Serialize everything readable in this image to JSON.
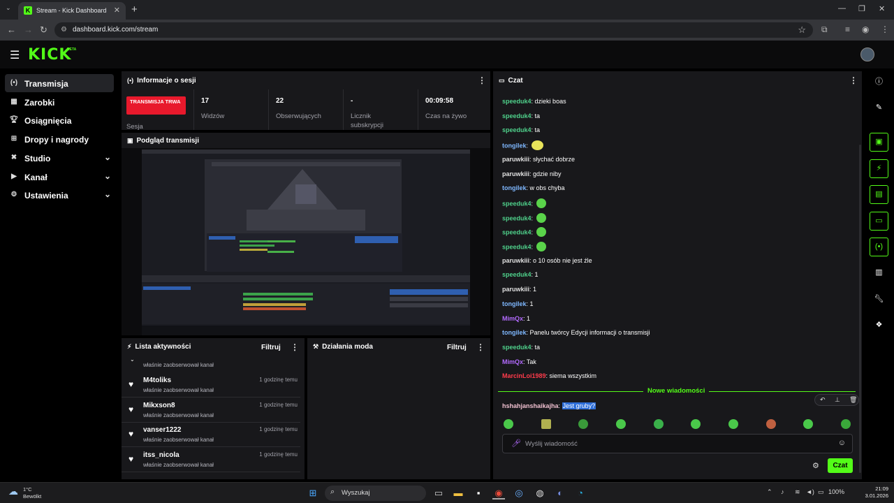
{
  "browser": {
    "tab_title": "Stream - Kick Dashboard",
    "tab_favicon": "K",
    "url": "dashboard.kick.com/stream"
  },
  "header": {
    "logo": "KICK",
    "logo_badge": "BETA"
  },
  "sidebar": {
    "items": [
      {
        "label": "Transmisja",
        "icon": "broadcast-icon"
      },
      {
        "label": "Zarobki",
        "icon": "earnings-icon"
      },
      {
        "label": "Osiągnięcia",
        "icon": "trophy-icon"
      },
      {
        "label": "Dropy i nagrody",
        "icon": "gift-icon"
      },
      {
        "label": "Studio",
        "icon": "studio-icon"
      },
      {
        "label": "Kanał",
        "icon": "channel-icon"
      },
      {
        "label": "Ustawienia",
        "icon": "settings-icon"
      }
    ]
  },
  "session": {
    "title": "Informacje o sesji",
    "status_badge": "TRANSMISJA TRWA",
    "status_label": "Sesja",
    "stats": [
      {
        "value": "17",
        "label": "Widzów"
      },
      {
        "value": "22",
        "label": "Obserwujących"
      },
      {
        "value": "-",
        "label": "Licznik subskrypcji"
      },
      {
        "value": "00:09:58",
        "label": "Czas na żywo"
      }
    ]
  },
  "preview": {
    "title": "Podgląd transmisji"
  },
  "activity": {
    "title": "Lista aktywności",
    "filter_label": "Filtruj",
    "partial_item_desc": "właśnie zaobserwował kanał",
    "items": [
      {
        "name": "M4toliks",
        "desc": "właśnie zaobserwował kanał",
        "time": "1 godzinę temu"
      },
      {
        "name": "Mikxson8",
        "desc": "właśnie zaobserwował kanał",
        "time": "1 godzinę temu"
      },
      {
        "name": "vanser1222",
        "desc": "właśnie zaobserwował kanał",
        "time": "1 godzinę temu"
      },
      {
        "name": "itss_nicola",
        "desc": "właśnie zaobserwował kanał",
        "time": "1 godzinę temu"
      }
    ]
  },
  "mod": {
    "title": "Działania moda",
    "filter_label": "Filtruj"
  },
  "chat": {
    "title": "Czat",
    "messages": [
      {
        "user": "speeduk4",
        "color": "green",
        "text": "dzieki boas"
      },
      {
        "user": "speeduk4",
        "color": "green",
        "text": "ta"
      },
      {
        "user": "speeduk4",
        "color": "green",
        "text": "ta"
      },
      {
        "user": "tongilek",
        "color": "blue",
        "text": "",
        "emote": "yellow"
      },
      {
        "user": "paruwkiii",
        "color": "white",
        "text": "słychać dobrze"
      },
      {
        "user": "paruwkiii",
        "color": "white",
        "text": "gdzie niby"
      },
      {
        "user": "tongilek",
        "color": "blue",
        "text": "w obs chyba"
      },
      {
        "user": "speeduk4",
        "color": "green",
        "text": "",
        "emote": "green"
      },
      {
        "user": "speeduk4",
        "color": "green",
        "text": "",
        "emote": "green"
      },
      {
        "user": "speeduk4",
        "color": "green",
        "text": "",
        "emote": "green"
      },
      {
        "user": "speeduk4",
        "color": "green",
        "text": "",
        "emote": "green"
      },
      {
        "user": "paruwkiii",
        "color": "white",
        "text": "o 10 osób nie jest źle"
      },
      {
        "user": "speeduk4",
        "color": "green",
        "text": "1"
      },
      {
        "user": "paruwkiii",
        "color": "white",
        "text": "1"
      },
      {
        "user": "tongilek",
        "color": "blue",
        "text": "1"
      },
      {
        "user": "MimQx",
        "color": "purple",
        "text": "1"
      },
      {
        "user": "tongilek",
        "color": "blue",
        "text": "Panelu twórcy Edycji informacji o transmisji"
      },
      {
        "user": "speeduk4",
        "color": "green",
        "text": "ta"
      },
      {
        "user": "MimQx",
        "color": "purple",
        "text": "Tak"
      },
      {
        "user": "MarcinLoi1989",
        "color": "red",
        "text": "siema wszystkim"
      }
    ],
    "new_messages_label": "Nowe wiadomości",
    "new_message": {
      "user": "hshahjanshaikajha",
      "text": "Jest gruby?"
    },
    "input_placeholder": "Wyślij wiadomość",
    "send_button": "Czat"
  },
  "taskbar": {
    "weather_temp": "1°C",
    "weather_desc": "Bewölkt",
    "search_label": "Wyszukaj",
    "battery": "100%",
    "time": "21:09",
    "date": "3.01.2026"
  },
  "colors": {
    "accent": "#53fc18",
    "live_red": "#e8192c"
  }
}
